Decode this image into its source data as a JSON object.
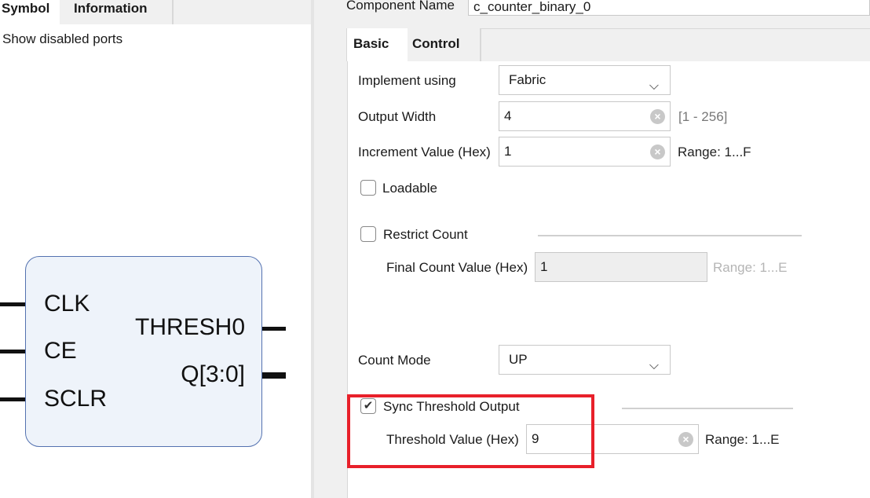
{
  "left_panel": {
    "tabs": [
      {
        "label": "Symbol"
      },
      {
        "label": "Information"
      }
    ],
    "show_disabled_ports": "Show disabled ports",
    "symbol": {
      "inputs": [
        "CLK",
        "CE",
        "SCLR"
      ],
      "outputs": [
        "THRESH0",
        "Q[3:0]"
      ]
    }
  },
  "component": {
    "label": "Component Name",
    "value": "c_counter_binary_0"
  },
  "tabs": [
    {
      "label": "Basic",
      "active": true
    },
    {
      "label": "Control",
      "active": false
    }
  ],
  "basic": {
    "implement_using": {
      "label": "Implement using",
      "value": "Fabric"
    },
    "output_width": {
      "label": "Output Width",
      "value": "4",
      "hint": "[1 - 256]"
    },
    "increment_value": {
      "label": "Increment Value (Hex)",
      "value": "1",
      "hint": "Range: 1...F"
    },
    "loadable": {
      "label": "Loadable",
      "checked": false
    },
    "restrict_count": {
      "label": "Restrict Count",
      "checked": false
    },
    "final_count": {
      "label": "Final Count Value (Hex)",
      "value": "1",
      "hint": "Range: 1...E",
      "disabled": true
    },
    "count_mode": {
      "label": "Count Mode",
      "value": "UP"
    },
    "sync_threshold": {
      "label": "Sync Threshold Output",
      "checked": true
    },
    "threshold_value": {
      "label": "Threshold Value (Hex)",
      "value": "9",
      "hint": "Range: 1...E"
    }
  },
  "highlight_color": "#e8202a"
}
